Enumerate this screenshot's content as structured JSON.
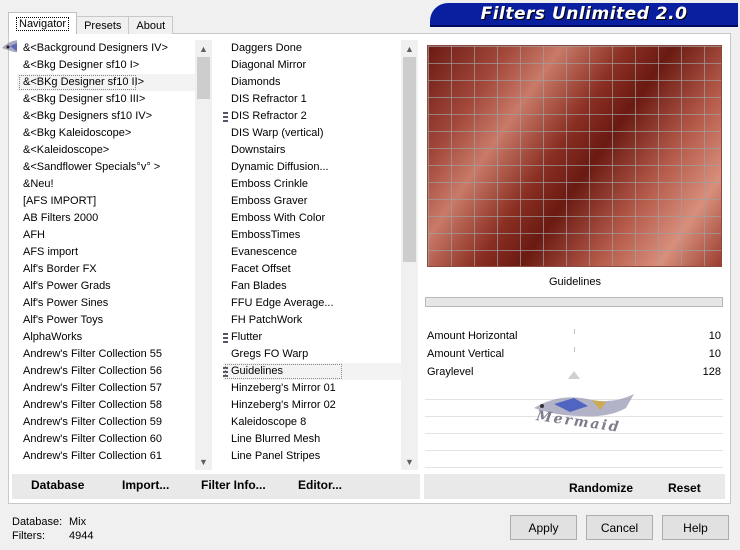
{
  "banner": {
    "title": "Filters Unlimited 2.0"
  },
  "tabs": [
    {
      "label": "Navigator",
      "active": true
    },
    {
      "label": "Presets",
      "active": false
    },
    {
      "label": "About",
      "active": false
    }
  ],
  "categories": [
    "&<Background Designers IV>",
    "&<Bkg Designer sf10 I>",
    "&<BKg Designer sf10 II>",
    "&<Bkg Designer sf10 III>",
    "&<Bkg Designers sf10 IV>",
    "&<Bkg Kaleidoscope>",
    "&<Kaleidoscope>",
    "&<Sandflower Specials°v° >",
    "&Neu!",
    "[AFS IMPORT]",
    "AB Filters 2000",
    "AFH",
    "AFS import",
    "Alf's Border FX",
    "Alf's Power Grads",
    "Alf's Power Sines",
    "Alf's Power Toys",
    "AlphaWorks",
    "Andrew's Filter Collection 55",
    "Andrew's Filter Collection 56",
    "Andrew's Filter Collection 57",
    "Andrew's Filter Collection 58",
    "Andrew's Filter Collection 59",
    "Andrew's Filter Collection 60",
    "Andrew's Filter Collection 61"
  ],
  "selected_category_index": 2,
  "filters": [
    {
      "label": "Daggers Done",
      "mark": false
    },
    {
      "label": "Diagonal Mirror",
      "mark": false
    },
    {
      "label": "Diamonds",
      "mark": false
    },
    {
      "label": "DIS Refractor 1",
      "mark": false
    },
    {
      "label": "DIS Refractor 2",
      "mark": true
    },
    {
      "label": "DIS Warp (vertical)",
      "mark": false
    },
    {
      "label": "Downstairs",
      "mark": false
    },
    {
      "label": "Dynamic Diffusion...",
      "mark": false
    },
    {
      "label": "Emboss Crinkle",
      "mark": false
    },
    {
      "label": "Emboss Graver",
      "mark": false
    },
    {
      "label": "Emboss With Color",
      "mark": false
    },
    {
      "label": "EmbossTimes",
      "mark": false
    },
    {
      "label": "Evanescence",
      "mark": false
    },
    {
      "label": "Facet Offset",
      "mark": false
    },
    {
      "label": "Fan Blades",
      "mark": false
    },
    {
      "label": "FFU Edge Average...",
      "mark": false
    },
    {
      "label": "FH PatchWork",
      "mark": false
    },
    {
      "label": "Flutter",
      "mark": true
    },
    {
      "label": "Gregs FO Warp",
      "mark": false
    },
    {
      "label": "Guidelines",
      "mark": true
    },
    {
      "label": "Hinzeberg's Mirror 01",
      "mark": false
    },
    {
      "label": "Hinzeberg's Mirror 02",
      "mark": false
    },
    {
      "label": "Kaleidoscope 8",
      "mark": false
    },
    {
      "label": "Line Blurred Mesh",
      "mark": false
    },
    {
      "label": "Line Panel Stripes",
      "mark": false
    }
  ],
  "selected_filter_index": 19,
  "left_buttons": {
    "database": "Database",
    "import": "Import...",
    "filter_info": "Filter Info...",
    "editor": "Editor..."
  },
  "filter_name": "Guidelines",
  "params": [
    {
      "label": "Amount Horizontal",
      "value": "10"
    },
    {
      "label": "Amount Vertical",
      "value": "10"
    },
    {
      "label": "Graylevel",
      "value": "128"
    }
  ],
  "watermark": "Mermaid",
  "right_buttons": {
    "randomize": "Randomize",
    "reset": "Reset"
  },
  "status": {
    "database_label": "Database:",
    "database_value": "Mix",
    "filters_label": "Filters:",
    "filters_value": "4944"
  },
  "footer_buttons": {
    "apply": "Apply",
    "cancel": "Cancel",
    "help": "Help"
  },
  "colors": {
    "banner": "#0a1fa0",
    "preview_base": "#8a2e22"
  }
}
